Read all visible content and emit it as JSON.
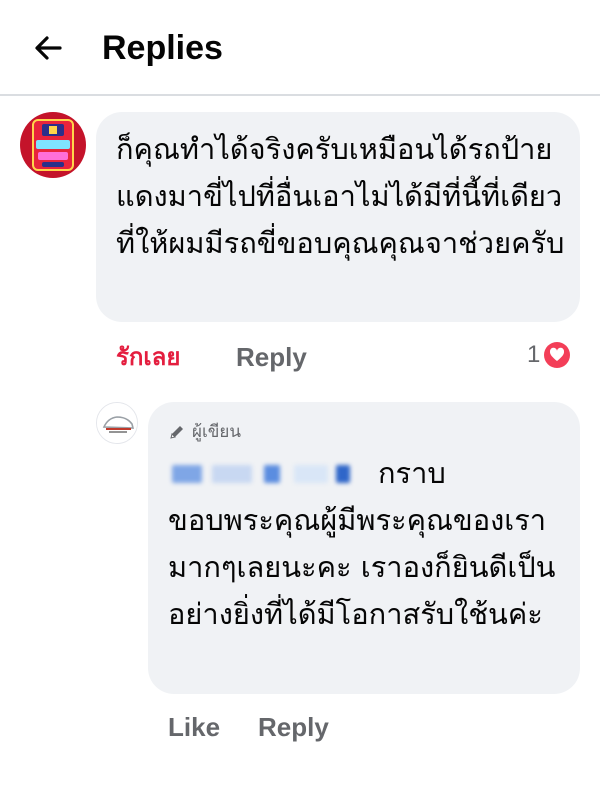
{
  "header": {
    "title": "Replies",
    "back_icon": "arrow-left-icon"
  },
  "comment": {
    "avatar_icon": "profile-avatar-red-logo",
    "text": "ก็คุณทำได้จริงครับเหมือนได้รถป้ายแดงมาขี่ไปที่อื่นเอาไม่ได้มีที่นี้ที่เดียวที่ให้ผมมีรถขี่ขอบคุณคุณจาช่วยครับ",
    "like_label": "รักเลย",
    "reply_label": "Reply",
    "reaction_count": "1",
    "reaction_icon": "heart-icon",
    "reaction_color": "#f33e58",
    "like_color": "#e41e3f"
  },
  "reply": {
    "avatar_icon": "page-avatar-car-logo",
    "author_badge_icon": "pencil-icon",
    "author_badge": "ผู้เขียน",
    "text_after_name": "กราบขอบพระคุณผู้มีพระคุณของเรามากๆเลยนะคะ เราองก็ยินดีเป็นอย่างยิ่งที่ได้มีโอกาสรับใช้นค่ะ",
    "like_label": "Like",
    "reply_label": "Reply"
  },
  "colors": {
    "bubble_bg": "#f0f2f5",
    "secondary_text": "#65676b",
    "primary_text": "#050505"
  }
}
